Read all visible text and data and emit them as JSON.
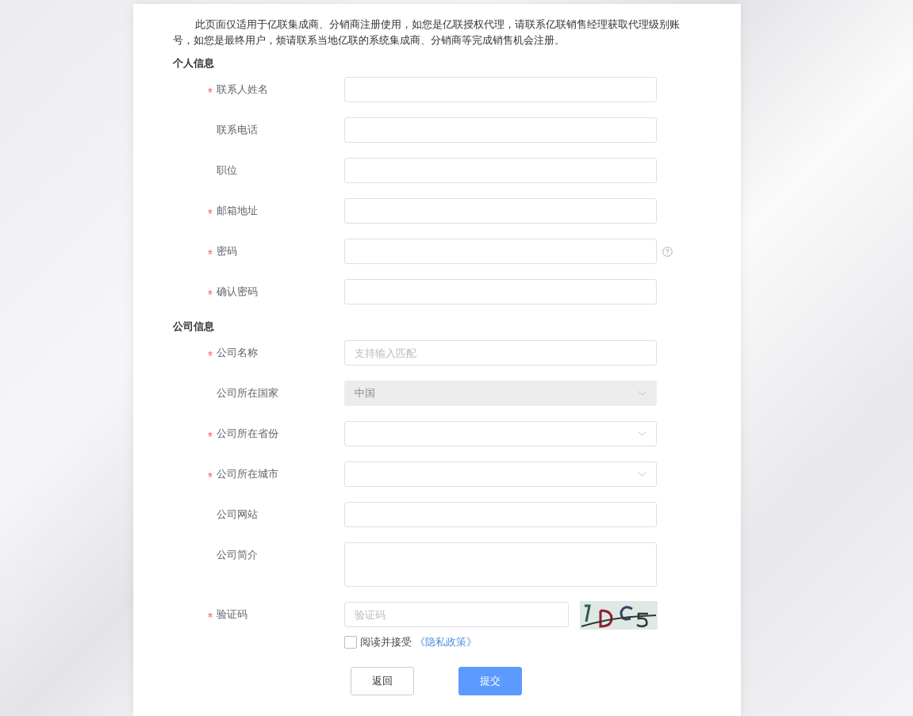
{
  "notice": "此页面仅适用于亿联集成商、分销商注册使用，如您是亿联授权代理，请联系亿联销售经理获取代理级别账号，如您是最终用户，烦请联系当地亿联的系统集成商、分销商等完成销售机会注册。",
  "sections": [
    {
      "title": "个人信息",
      "fields": [
        {
          "kind": "text",
          "label": "联系人姓名",
          "required": true
        },
        {
          "kind": "text",
          "label": "联系电话",
          "required": false
        },
        {
          "kind": "text",
          "label": "职位",
          "required": false
        },
        {
          "kind": "text",
          "label": "邮箱地址",
          "required": true
        },
        {
          "kind": "text",
          "label": "密码",
          "required": true,
          "help": true
        },
        {
          "kind": "text",
          "label": "确认密码",
          "required": true
        }
      ]
    },
    {
      "title": "公司信息",
      "fields": [
        {
          "kind": "text",
          "label": "公司名称",
          "required": true,
          "placeholder": "支持输入匹配"
        },
        {
          "kind": "select",
          "label": "公司所在国家",
          "required": false,
          "value": "中国",
          "disabled": true
        },
        {
          "kind": "select",
          "label": "公司所在省份",
          "required": true,
          "disabled": false
        },
        {
          "kind": "select",
          "label": "公司所在城市",
          "required": true,
          "disabled": false
        },
        {
          "kind": "text",
          "label": "公司网站",
          "required": false
        },
        {
          "kind": "textarea",
          "label": "公司简介",
          "required": false
        },
        {
          "kind": "captcha",
          "label": "验证码",
          "required": true,
          "placeholder": "验证码"
        }
      ]
    }
  ],
  "agreement": {
    "checked": false,
    "text": "阅读并接受",
    "link": "《隐私政策》"
  },
  "buttons": [
    {
      "label": "返回",
      "kind": "secondary"
    },
    {
      "label": "提交",
      "kind": "primary"
    }
  ]
}
